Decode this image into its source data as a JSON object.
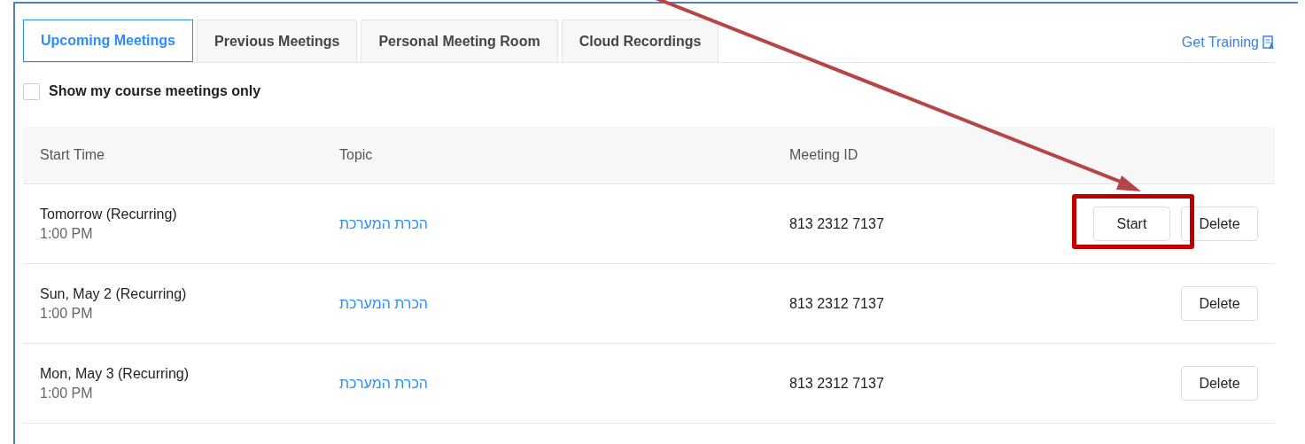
{
  "tabs": [
    {
      "label": "Upcoming Meetings",
      "selected": true
    },
    {
      "label": "Previous Meetings",
      "selected": false
    },
    {
      "label": "Personal Meeting Room",
      "selected": false
    },
    {
      "label": "Cloud Recordings",
      "selected": false
    }
  ],
  "training_link": "Get Training",
  "filter": {
    "label": "Show my course meetings only",
    "checked": false
  },
  "table": {
    "columns": [
      "Start Time",
      "Topic",
      "Meeting ID"
    ],
    "rows": [
      {
        "start_time": "Tomorrow (Recurring)",
        "time": "1:00 PM",
        "topic": "הכרת המערכת",
        "meeting_id": "813 2312 7137",
        "buttons": [
          "Start",
          "Delete"
        ],
        "highlighted": true
      },
      {
        "start_time": "Sun, May 2 (Recurring)",
        "time": "1:00 PM",
        "topic": "הכרת המערכת",
        "meeting_id": "813 2312 7137",
        "buttons": [
          "Delete"
        ],
        "highlighted": false
      },
      {
        "start_time": "Mon, May 3 (Recurring)",
        "time": "1:00 PM",
        "topic": "הכרת המערכת",
        "meeting_id": "813 2312 7137",
        "buttons": [
          "Delete"
        ],
        "highlighted": false
      }
    ]
  }
}
